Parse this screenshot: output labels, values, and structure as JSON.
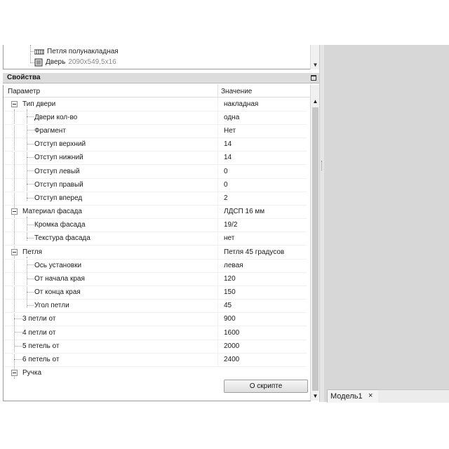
{
  "tree": {
    "items": [
      {
        "label": "Петля полунакладная",
        "icon": "hinge-icon",
        "detail": ""
      },
      {
        "label": "Дверь",
        "icon": "door-icon",
        "detail": "2090x549,5x16"
      }
    ]
  },
  "properties": {
    "title": "Свойства",
    "col_param": "Параметр",
    "col_value": "Значение",
    "rows": [
      {
        "name": "Тип двери",
        "value": "накладная"
      },
      {
        "name": "Двери кол-во",
        "value": "одна"
      },
      {
        "name": "Фрагмент",
        "value": "Нет"
      },
      {
        "name": "Отступ верхний",
        "value": "14"
      },
      {
        "name": "Отступ нижний",
        "value": "14"
      },
      {
        "name": "Отступ левый",
        "value": "0"
      },
      {
        "name": "Отступ правый",
        "value": "0"
      },
      {
        "name": "Отступ вперед",
        "value": "2"
      },
      {
        "name": "Материал фасада",
        "value": "ЛДСП 16 мм"
      },
      {
        "name": "Кромка фасада",
        "value": "19/2"
      },
      {
        "name": "Текстура фасада",
        "value": "нет"
      },
      {
        "name": "Петля",
        "value": "Петля 45 градусов"
      },
      {
        "name": "Ось установки",
        "value": "левая"
      },
      {
        "name": "От начала края",
        "value": "120"
      },
      {
        "name": "От конца края",
        "value": "150"
      },
      {
        "name": "Угол петли",
        "value": "45"
      },
      {
        "name": "3 петли от",
        "value": "900"
      },
      {
        "name": "4 петли от",
        "value": "1600"
      },
      {
        "name": "5 петель от",
        "value": "2000"
      },
      {
        "name": "6 петель от",
        "value": "2400"
      },
      {
        "name": "Ручка",
        "value": ""
      }
    ],
    "script_button": "О скрипте"
  },
  "tabs": {
    "model_tab": "Модель1",
    "close_glyph": "×"
  },
  "icons": {
    "up_arrow": "▲",
    "down_arrow": "▼"
  }
}
